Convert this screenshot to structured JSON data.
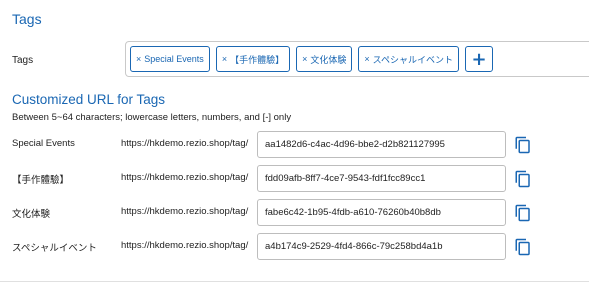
{
  "tags_section": {
    "title": "Tags",
    "field_label": "Tags",
    "chips": [
      {
        "remove": "×",
        "label": "Special Events"
      },
      {
        "remove": "×",
        "label": "【手作體驗】"
      },
      {
        "remove": "×",
        "label": "文化体験"
      },
      {
        "remove": "×",
        "label": "スペシャルイベント"
      }
    ],
    "add_label": "+"
  },
  "url_section": {
    "title": "Customized URL for Tags",
    "hint": "Between 5~64 characters; lowercase letters, numbers, and [-] only",
    "rows": [
      {
        "label": "Special Events",
        "prefix": "https://hkdemo.rezio.shop/tag/",
        "slug": "aa1482d6-c4ac-4d96-bbe2-d2b821127995"
      },
      {
        "label": "【手作體驗】",
        "prefix": "https://hkdemo.rezio.shop/tag/",
        "slug": "fdd09afb-8ff7-4ce7-9543-fdf1fcc89cc1"
      },
      {
        "label": "文化体験",
        "prefix": "https://hkdemo.rezio.shop/tag/",
        "slug": "fabe6c42-1b95-4fdb-a610-76260b40b8db"
      },
      {
        "label": "スペシャルイベント",
        "prefix": "https://hkdemo.rezio.shop/tag/",
        "slug": "a4b174c9-2529-4fd4-866c-79c258bd4a1b"
      }
    ]
  },
  "colors": {
    "accent": "#1a67b3",
    "border": "#bdbdbd"
  },
  "icons": {
    "copy": "copy-icon"
  }
}
